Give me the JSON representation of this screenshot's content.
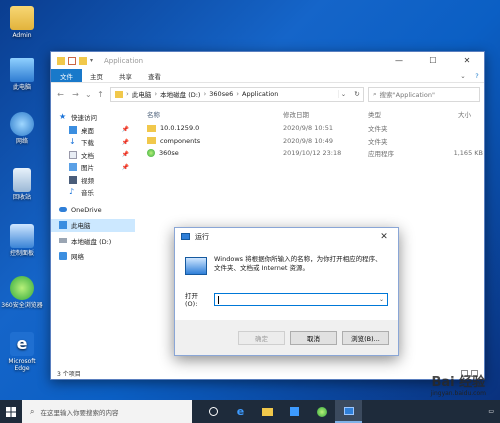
{
  "desktop": {
    "icons": [
      {
        "label": "Admin",
        "icon": "user-folder-icon"
      },
      {
        "label": "此电脑",
        "icon": "computer-icon"
      },
      {
        "label": "网络",
        "icon": "network-icon"
      },
      {
        "label": "回收站",
        "icon": "recycle-bin-icon"
      },
      {
        "label": "控制面板",
        "icon": "control-panel-icon"
      },
      {
        "label": "360安全浏览器",
        "icon": "360-browser-icon"
      },
      {
        "label": "Microsoft Edge",
        "icon": "edge-icon"
      }
    ]
  },
  "explorer": {
    "title": "Application",
    "ribbon_tabs": [
      "文件",
      "主页",
      "共享",
      "查看"
    ],
    "address": {
      "crumbs": [
        "此电脑",
        "本地磁盘 (D:)",
        "360se6",
        "Application"
      ]
    },
    "search_placeholder": "搜索\"Application\"",
    "nav": {
      "quick_access": "快速访问",
      "items": [
        {
          "label": "桌面",
          "pinned": true
        },
        {
          "label": "下载",
          "pinned": true
        },
        {
          "label": "文档",
          "pinned": true
        },
        {
          "label": "图片",
          "pinned": true
        },
        {
          "label": "视频",
          "pinned": false
        },
        {
          "label": "音乐",
          "pinned": false
        }
      ],
      "onedrive": "OneDrive",
      "this_pc": "此电脑",
      "local_disk": "本地磁盘 (D:)",
      "network": "网络"
    },
    "columns": {
      "name": "名称",
      "date": "修改日期",
      "type": "类型",
      "size": "大小"
    },
    "files": [
      {
        "name": "10.0.1259.0",
        "date": "2020/9/8 10:51",
        "type": "文件夹",
        "size": "",
        "kind": "folder"
      },
      {
        "name": "components",
        "date": "2020/9/8 10:49",
        "type": "文件夹",
        "size": "",
        "kind": "folder"
      },
      {
        "name": "360se",
        "date": "2019/10/12 23:18",
        "type": "应用程序",
        "size": "1,165 KB",
        "kind": "app"
      }
    ],
    "status": "3 个项目"
  },
  "run_dialog": {
    "title": "运行",
    "description_line1": "Windows 将根据你所输入的名称，为你打开相应的程序、",
    "description_line2": "文件夹、文档或 Internet 资源。",
    "open_label": "打开(O):",
    "open_value": "",
    "buttons": {
      "ok": "确定",
      "cancel": "取消",
      "browse": "浏览(B)..."
    }
  },
  "taskbar": {
    "search_placeholder": "在这里输入你要搜索的内容",
    "apps": [
      "cortana-icon",
      "edge-icon",
      "file-explorer-icon",
      "store-icon",
      "360-browser-icon",
      "run-icon"
    ]
  },
  "watermark": {
    "main": "Bai 经验",
    "sub": "jingyan.baidu.com"
  },
  "colors": {
    "accent": "#1979ca",
    "selection": "#cce8ff",
    "taskbar": "#1e2b3b"
  }
}
